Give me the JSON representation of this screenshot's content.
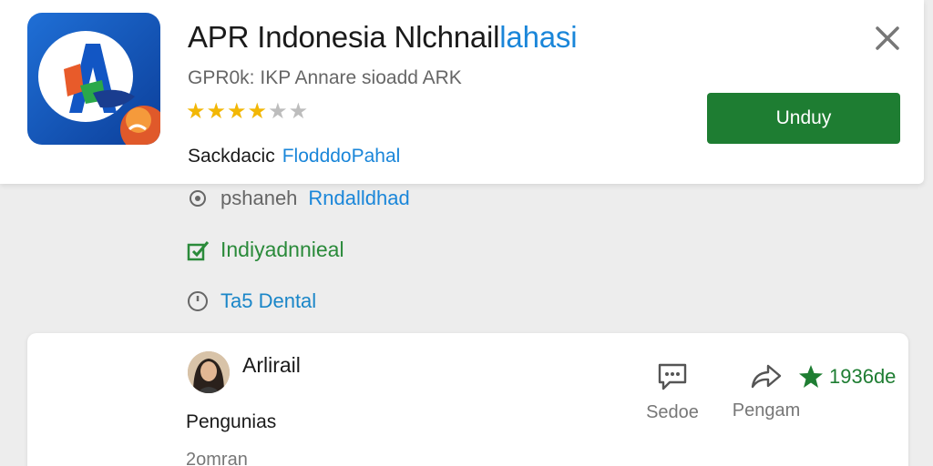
{
  "app": {
    "title_main": "APR Indonesia Nlchnail",
    "title_accent": "lahasi",
    "subtitle": "GPR0k:  IKP  Annare sioadd ARK",
    "rating_value": 4,
    "rating_max": 5,
    "developer_label": "Sackdacic",
    "developer_value": "FlodddoPahal",
    "install_label": "Unduy",
    "icon": "app-logo-icon",
    "close_icon": "close-icon"
  },
  "info": {
    "row1_key": "pshaneh",
    "row1_value": "Rndalldhad",
    "row2_text": "Indiyadnnieal",
    "row3_text": "Ta5 Dental"
  },
  "review": {
    "user_name": "Arlirail",
    "section_label": "Pengunias",
    "section_sub": "2omran",
    "comment_label": "Sedoe",
    "share_label": "Pengam",
    "star_count": "1936de"
  },
  "colors": {
    "install": "#1e7d32",
    "link": "#1a86d9",
    "star": "#f2b705"
  }
}
